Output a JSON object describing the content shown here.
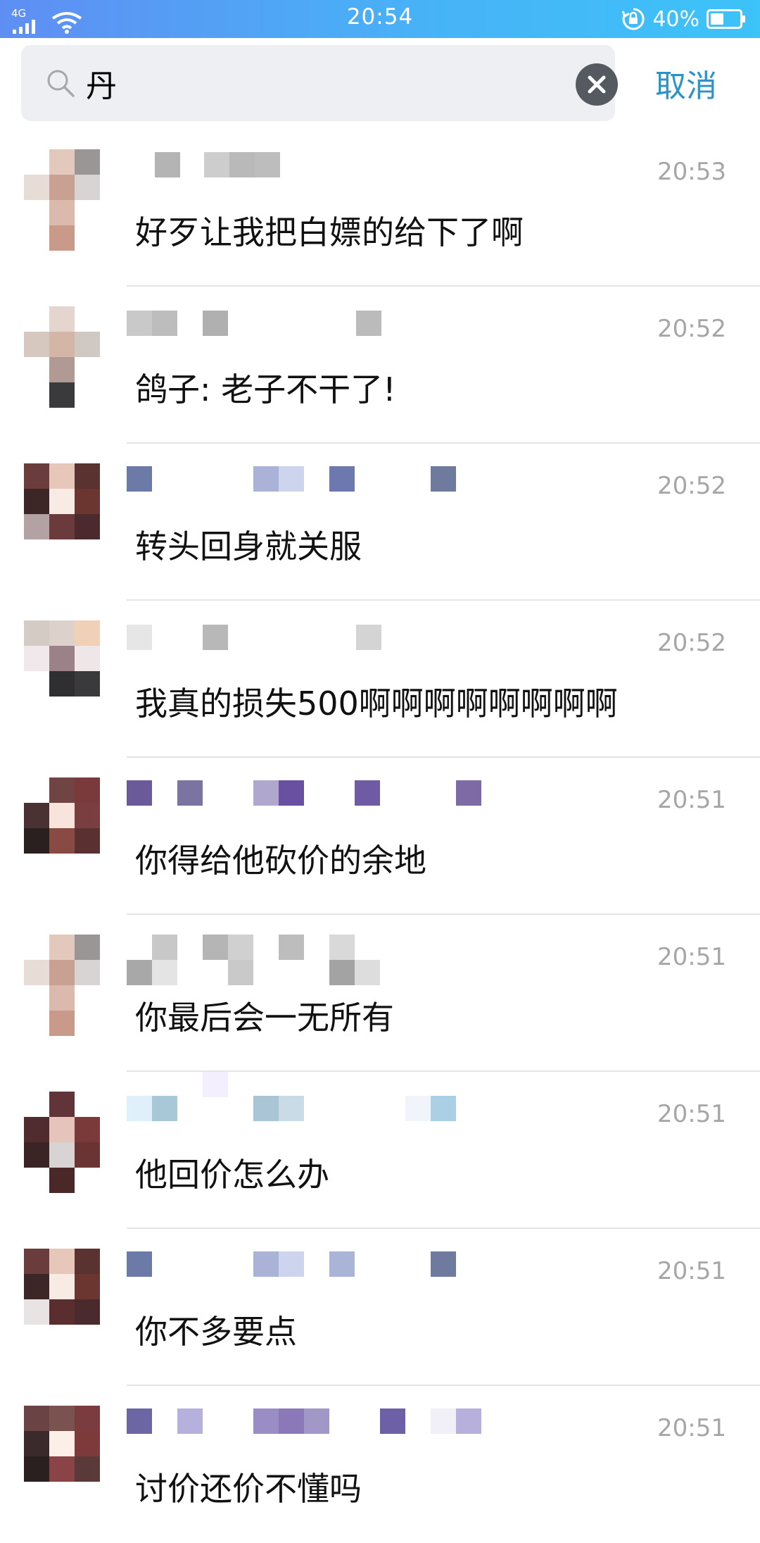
{
  "status_bar": {
    "network": "4G",
    "time": "20:54",
    "battery": "40%"
  },
  "search": {
    "query": "丹",
    "cancel_label": "取消"
  },
  "results": [
    {
      "message": "好歹让我把白嫖的给下了啊",
      "time": "20:53"
    },
    {
      "message": "鸽子: 老子不干了!",
      "time": "20:52"
    },
    {
      "message": "转头回身就关服",
      "time": "20:52"
    },
    {
      "message": "我真的损失500啊啊啊啊啊啊啊啊",
      "time": "20:52"
    },
    {
      "message": "你得给他砍价的余地",
      "time": "20:51"
    },
    {
      "message": "你最后会一无所有",
      "time": "20:51"
    },
    {
      "message": "他回价怎么办",
      "time": "20:51"
    },
    {
      "message": "你不多要点",
      "time": "20:51"
    },
    {
      "message": "讨价还价不懂吗",
      "time": "20:51"
    }
  ],
  "colors": {
    "status_bar_start": "#5f8ef3",
    "status_bar_end": "#3cc3f8",
    "accent": "#2b93c9",
    "time_text": "#a6a6a6",
    "search_bg": "#eeeff3"
  }
}
